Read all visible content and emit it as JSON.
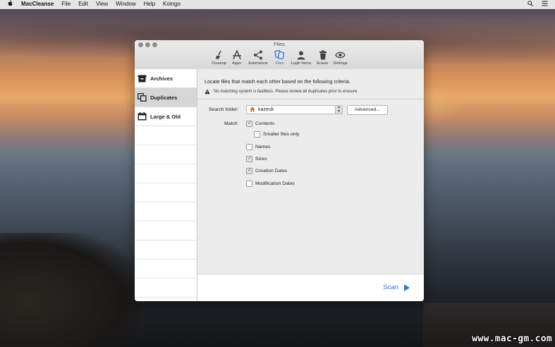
{
  "menubar": {
    "app_name": "MacCleanse",
    "items": [
      "File",
      "Edit",
      "View",
      "Window",
      "Help",
      "Koingo"
    ]
  },
  "window": {
    "title": "Files",
    "toolbar": [
      {
        "label": "Cleanup",
        "icon": "broom-icon"
      },
      {
        "label": "Apps",
        "icon": "apps-icon"
      },
      {
        "label": "Extensions",
        "icon": "share-icon"
      },
      {
        "label": "Files",
        "icon": "files-icon",
        "active": true
      },
      {
        "label": "Login Items",
        "icon": "user-icon"
      },
      {
        "label": "Eraser",
        "icon": "trash-icon"
      },
      {
        "label": "Settings",
        "icon": "eye-icon"
      }
    ],
    "sidebar": [
      {
        "label": "Archives",
        "icon": "archive-box-icon"
      },
      {
        "label": "Duplicates",
        "icon": "duplicates-icon",
        "selected": true
      },
      {
        "label": "Large & Old",
        "icon": "calendar-icon"
      }
    ],
    "content": {
      "description": "Locate files that match each other based on the following criteria.",
      "warning": "No matching system is faultless. Please review all duplicates prior to erasure.",
      "search_folder_label": "Search folder:",
      "search_folder_value": "kazeuk",
      "advanced_button": "Advanced...",
      "match_label": "Match:",
      "options": [
        {
          "label": "Contents",
          "checked": true
        },
        {
          "label": "Smaller files only",
          "checked": false
        },
        {
          "label": "Names",
          "checked": false
        },
        {
          "label": "Sizes",
          "checked": true
        },
        {
          "label": "Creation Dates",
          "checked": true
        },
        {
          "label": "Modification Dates",
          "checked": false
        }
      ]
    },
    "footer": {
      "scan_button": "Scan"
    }
  },
  "watermark": "www.mac-gm.com",
  "colors": {
    "accent": "#2f78d8"
  }
}
